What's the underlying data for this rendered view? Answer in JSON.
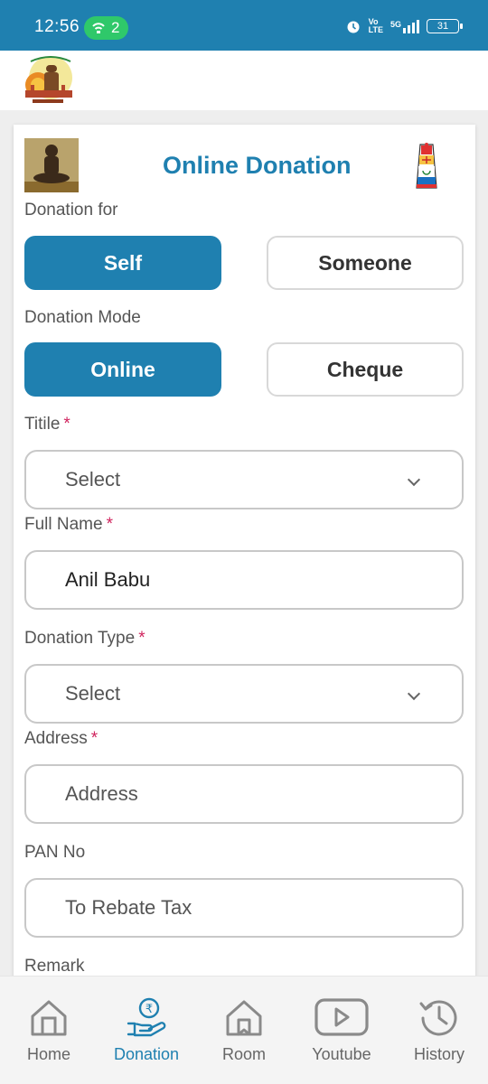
{
  "status_bar": {
    "time": "12:56",
    "hotspot_count": "2",
    "network": "5G",
    "battery": "31"
  },
  "form": {
    "title": "Online Donation",
    "donation_for_label": "Donation for",
    "donation_for_options": [
      "Self",
      "Someone"
    ],
    "donation_mode_label": "Donation Mode",
    "donation_mode_options": [
      "Online",
      "Cheque"
    ],
    "title_field": {
      "label": "Titile",
      "required": "*",
      "value": "Select"
    },
    "full_name": {
      "label": "Full Name",
      "required": "*",
      "value": "Anil Babu"
    },
    "donation_type": {
      "label": "Donation Type",
      "required": "*",
      "value": "Select"
    },
    "address": {
      "label": "Address",
      "required": "*",
      "placeholder": "Address"
    },
    "pan": {
      "label": "PAN No",
      "placeholder": "To Rebate Tax"
    },
    "remark": {
      "label": "Remark"
    }
  },
  "nav": {
    "items": [
      {
        "label": "Home",
        "icon": "home-icon"
      },
      {
        "label": "Donation",
        "icon": "donation-icon"
      },
      {
        "label": "Room",
        "icon": "room-icon"
      },
      {
        "label": "Youtube",
        "icon": "youtube-icon"
      },
      {
        "label": "History",
        "icon": "history-icon"
      }
    ],
    "active": "Donation"
  },
  "colors": {
    "primary": "#1f80b0",
    "required": "#d0245e",
    "hotspot": "#2fc86a"
  }
}
